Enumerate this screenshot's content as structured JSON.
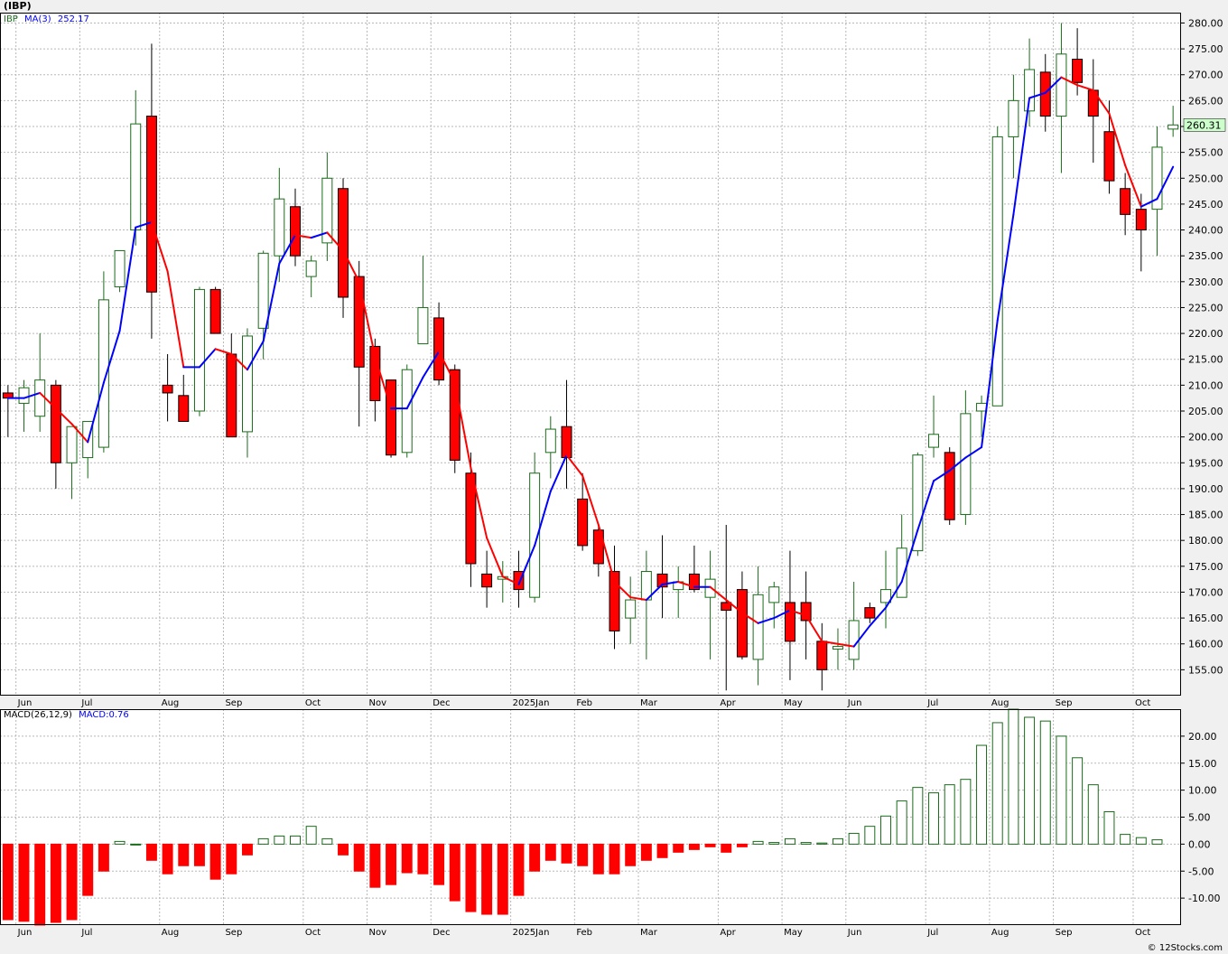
{
  "title": "(IBP)",
  "footer": "© 12Stocks.com",
  "colors": {
    "up": "#1a6b1a",
    "down": "#ff0000",
    "ma_up": "#0000ff",
    "ma_down": "#ff0000",
    "grid": "#b8b8b8",
    "price_label_bg": "#ccffcc"
  },
  "chart_data": [
    {
      "type": "candlestick",
      "legend": {
        "symbol": "IBP",
        "ma_label": "MA(3)",
        "ma_value": "252.17"
      },
      "price_label": "260.31",
      "ylim": [
        150,
        282
      ],
      "y_ticks": [
        155,
        160,
        165,
        170,
        175,
        180,
        185,
        190,
        195,
        200,
        205,
        210,
        215,
        220,
        225,
        230,
        235,
        240,
        245,
        250,
        255,
        260,
        265,
        270,
        275,
        280
      ],
      "x_labels": [
        {
          "label": "Jun",
          "week": 1
        },
        {
          "label": "Jul",
          "week": 5
        },
        {
          "label": "Aug",
          "week": 10
        },
        {
          "label": "Sep",
          "week": 14
        },
        {
          "label": "Oct",
          "week": 19
        },
        {
          "label": "Nov",
          "week": 23
        },
        {
          "label": "Dec",
          "week": 27
        },
        {
          "label": "2025Jan",
          "week": 32
        },
        {
          "label": "Feb",
          "week": 36
        },
        {
          "label": "Mar",
          "week": 40
        },
        {
          "label": "Apr",
          "week": 45
        },
        {
          "label": "May",
          "week": 49
        },
        {
          "label": "Jun",
          "week": 53
        },
        {
          "label": "Jul",
          "week": 58
        },
        {
          "label": "Aug",
          "week": 62
        },
        {
          "label": "Sep",
          "week": 66
        },
        {
          "label": "Oct",
          "week": 71
        }
      ],
      "ohlc": [
        [
          208.5,
          210,
          200,
          207.5
        ],
        [
          206.5,
          211,
          201,
          209.5
        ],
        [
          204,
          220,
          201,
          211
        ],
        [
          210,
          211,
          190,
          195
        ],
        [
          195,
          202,
          188,
          202
        ],
        [
          196,
          202,
          192,
          203
        ],
        [
          198,
          232,
          197,
          226.5
        ],
        [
          229,
          236,
          228,
          236
        ],
        [
          240,
          267,
          237,
          260.5
        ],
        [
          262,
          276,
          219,
          228
        ],
        [
          210,
          216,
          203,
          208.5
        ],
        [
          208,
          212,
          203,
          203
        ],
        [
          205,
          229,
          204,
          228.5
        ],
        [
          228.5,
          229,
          221,
          220
        ],
        [
          216,
          220,
          200,
          200
        ],
        [
          201,
          221,
          196,
          219.5
        ],
        [
          221,
          236,
          215,
          235.5
        ],
        [
          235,
          252,
          230,
          246
        ],
        [
          244.5,
          248,
          233,
          235
        ],
        [
          231,
          235,
          227,
          234
        ],
        [
          237.5,
          255,
          234,
          250
        ],
        [
          248,
          250,
          223,
          227
        ],
        [
          231,
          234,
          202,
          213.5
        ],
        [
          217.5,
          219,
          203,
          207
        ],
        [
          211,
          211,
          196,
          196.5
        ],
        [
          197,
          214,
          196,
          213
        ],
        [
          218,
          235,
          218,
          225
        ],
        [
          223,
          226,
          210,
          211
        ],
        [
          213,
          214,
          193,
          195.5
        ],
        [
          193,
          197,
          171,
          175.5
        ],
        [
          173.5,
          178,
          167,
          171
        ],
        [
          172.5,
          176,
          168,
          173
        ],
        [
          174,
          178,
          167,
          170.5
        ],
        [
          169,
          197,
          168,
          193
        ],
        [
          197,
          204,
          192,
          201.5
        ],
        [
          202,
          211,
          190,
          196
        ],
        [
          188,
          193,
          178,
          179
        ],
        [
          182,
          183,
          173,
          175.5
        ],
        [
          174,
          179,
          159,
          162.5
        ],
        [
          165,
          173,
          160,
          168.5
        ],
        [
          168.5,
          178,
          157,
          174
        ],
        [
          173.5,
          181,
          165,
          171
        ],
        [
          170.5,
          175,
          165,
          172
        ],
        [
          173.5,
          179,
          170,
          170.5
        ],
        [
          169,
          178,
          157,
          172.5
        ],
        [
          168,
          183,
          151,
          166.5
        ],
        [
          170.5,
          174,
          157,
          157.5
        ],
        [
          157,
          175,
          152,
          169.5
        ],
        [
          168,
          172,
          163,
          171
        ],
        [
          168,
          178,
          153,
          160.5
        ],
        [
          168,
          174,
          157,
          164.5
        ],
        [
          160.5,
          164,
          151,
          155
        ],
        [
          159,
          163,
          155,
          159.5
        ],
        [
          157,
          172,
          155,
          164.5
        ],
        [
          167,
          168,
          164,
          165
        ],
        [
          168,
          178,
          163,
          170.5
        ],
        [
          169,
          185,
          169,
          178.5
        ],
        [
          178,
          197,
          177,
          196.5
        ],
        [
          198,
          208,
          196,
          200.5
        ],
        [
          197,
          198,
          183,
          184
        ],
        [
          185,
          209,
          183,
          204.5
        ],
        [
          205,
          208,
          200,
          206.5
        ],
        [
          206,
          260,
          206,
          258
        ],
        [
          258,
          270,
          250,
          265
        ],
        [
          263,
          277,
          260,
          271
        ],
        [
          270.5,
          274,
          259,
          262
        ],
        [
          262,
          280,
          251,
          274
        ],
        [
          273,
          279,
          266,
          268.5
        ],
        [
          267,
          273,
          253,
          262
        ],
        [
          259,
          265,
          247,
          249.5
        ],
        [
          248,
          251,
          239,
          243
        ],
        [
          244,
          247,
          232,
          240
        ],
        [
          244,
          260,
          235,
          256
        ],
        [
          259.5,
          264,
          258,
          260.3
        ]
      ],
      "ma": [
        207.5,
        207.5,
        208.5,
        205.5,
        202.5,
        199,
        210.5,
        220.5,
        240.5,
        241.5,
        232,
        213.5,
        213.5,
        217,
        216,
        213,
        218.5,
        233.5,
        239,
        238.5,
        239.5,
        236,
        230,
        215.5,
        205.5,
        205.5,
        211.5,
        216.5,
        210.5,
        194,
        180.5,
        173,
        171.5,
        179,
        189.5,
        196.5,
        192.5,
        183,
        172,
        169,
        168.5,
        171.5,
        172,
        171,
        171,
        168.5,
        166,
        164,
        165,
        166.5,
        165.5,
        160.5,
        160,
        159.5,
        163.5,
        167,
        172,
        182,
        191.5,
        193.5,
        196,
        198,
        222.5,
        243,
        265.5,
        266.5,
        269.5,
        268,
        267,
        262.5,
        252.5,
        244.5,
        246,
        252.2
      ]
    },
    {
      "type": "bar",
      "legend": {
        "label": "MACD(26,12,9)",
        "value_label": "MACD:0.76"
      },
      "ylim": [
        -15,
        25
      ],
      "y_ticks": [
        -10,
        -5,
        0,
        5,
        10,
        15,
        20
      ],
      "y_tick_labels": [
        "-10.00",
        "-5.00",
        "0.00",
        "5.00",
        "10.00",
        "15.00",
        "20.00"
      ],
      "values": [
        -14,
        -14.3,
        -15,
        -14.5,
        -14,
        -9.5,
        -5,
        0.5,
        0,
        -3,
        -5.5,
        -4,
        -4,
        -6.5,
        -5.5,
        -2,
        1,
        1.5,
        1.5,
        3.3,
        1,
        -2,
        -5,
        -8,
        -7.5,
        -5.3,
        -5.5,
        -7.5,
        -10.5,
        -12.5,
        -13,
        -13,
        -9.5,
        -5,
        -3,
        -3.5,
        -4,
        -5.5,
        -5.5,
        -4,
        -3,
        -2.5,
        -1.5,
        -1,
        -0.5,
        -1.5,
        -0.5,
        0.5,
        0.3,
        1,
        0.3,
        0.2,
        1,
        2,
        3.3,
        5.2,
        8,
        10.5,
        9.5,
        11,
        12,
        18.3,
        22.5,
        25,
        23.5,
        22.8,
        20,
        16,
        11,
        6,
        1.8,
        1.2,
        0.8
      ]
    }
  ]
}
